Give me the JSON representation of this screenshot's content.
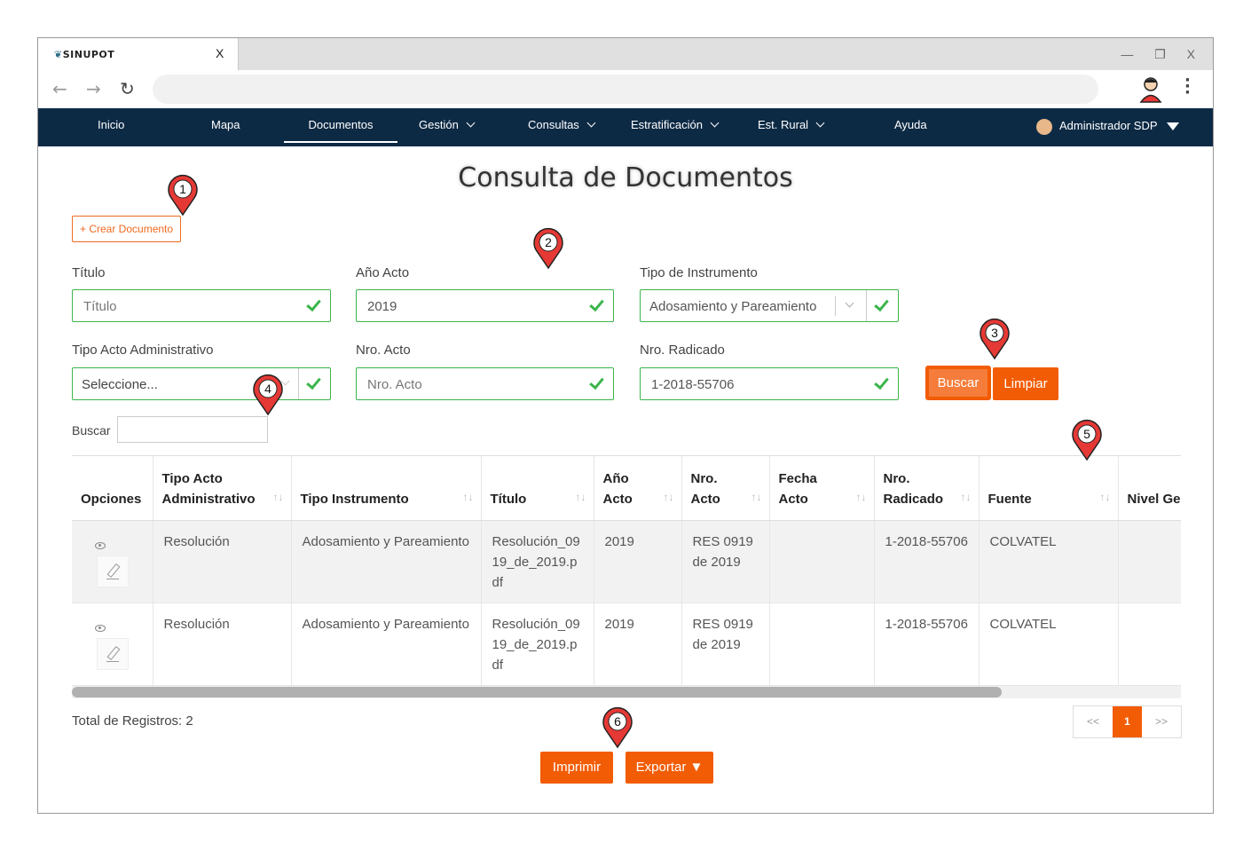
{
  "browser": {
    "tab_title": "SINUPOT",
    "tab_close": "X",
    "window_controls": [
      "—",
      "❐",
      "X"
    ]
  },
  "navbar": {
    "items": [
      {
        "label": "Inicio"
      },
      {
        "label": "Mapa"
      },
      {
        "label": "Documentos",
        "active": true
      },
      {
        "label": "Gestión",
        "dropdown": true
      },
      {
        "label": "Consultas",
        "dropdown": true
      },
      {
        "label": "Estratificación",
        "dropdown": true
      },
      {
        "label": "Est. Rural",
        "dropdown": true
      },
      {
        "label": "Ayuda"
      }
    ],
    "user": "Administrador SDP"
  },
  "page": {
    "title": "Consulta de Documentos",
    "create_button": "+ Crear Documento"
  },
  "form": {
    "titulo": {
      "label": "Título",
      "placeholder": "Título"
    },
    "anio_acto": {
      "label": "Año Acto",
      "value": "2019"
    },
    "tipo_instrumento": {
      "label": "Tipo de Instrumento",
      "value": "Adosamiento y Pareamiento"
    },
    "tipo_acto": {
      "label": "Tipo Acto Administrativo",
      "placeholder": "Seleccione..."
    },
    "nro_acto": {
      "label": "Nro. Acto",
      "placeholder": "Nro. Acto"
    },
    "nro_radicado": {
      "label": "Nro. Radicado",
      "value": "1-2018-55706"
    },
    "buscar_button": "Buscar",
    "limpiar_button": "Limpiar"
  },
  "table": {
    "search_label": "Buscar",
    "columns": [
      "Opciones",
      "Tipo Acto Administrativo",
      "Tipo Instrumento",
      "Título",
      "Año Acto",
      "Nro. Acto",
      "Fecha Acto",
      "Nro. Radicado",
      "Fuente",
      "Nivel Geográf"
    ],
    "rows": [
      {
        "tipo_acto": "Resolución",
        "tipo_instrumento": "Adosamiento y Pareamiento",
        "titulo": "Resolución_0919_de_2019.pdf",
        "anio": "2019",
        "nro_acto": "RES 0919 de 2019",
        "fecha": "",
        "radicado": "1-2018-55706",
        "fuente": "COLVATEL",
        "nivel": ""
      },
      {
        "tipo_acto": "Resolución",
        "tipo_instrumento": "Adosamiento y Pareamiento",
        "titulo": "Resolución_0919_de_2019.pdf",
        "anio": "2019",
        "nro_acto": "RES 0919 de 2019",
        "fecha": "",
        "radicado": "1-2018-55706",
        "fuente": "COLVATEL",
        "nivel": ""
      }
    ],
    "total": "Total de Registros: 2"
  },
  "pager": {
    "prev": "<<",
    "current": "1",
    "next": ">>"
  },
  "actions": {
    "imprimir": "Imprimir",
    "exportar": "Exportar ▼"
  },
  "markers": [
    "1",
    "2",
    "3",
    "4",
    "5",
    "6"
  ],
  "colors": {
    "navbar": "#0d2a45",
    "accent": "#f25c05",
    "valid": "#3bb54a",
    "marker": "#e53935"
  }
}
